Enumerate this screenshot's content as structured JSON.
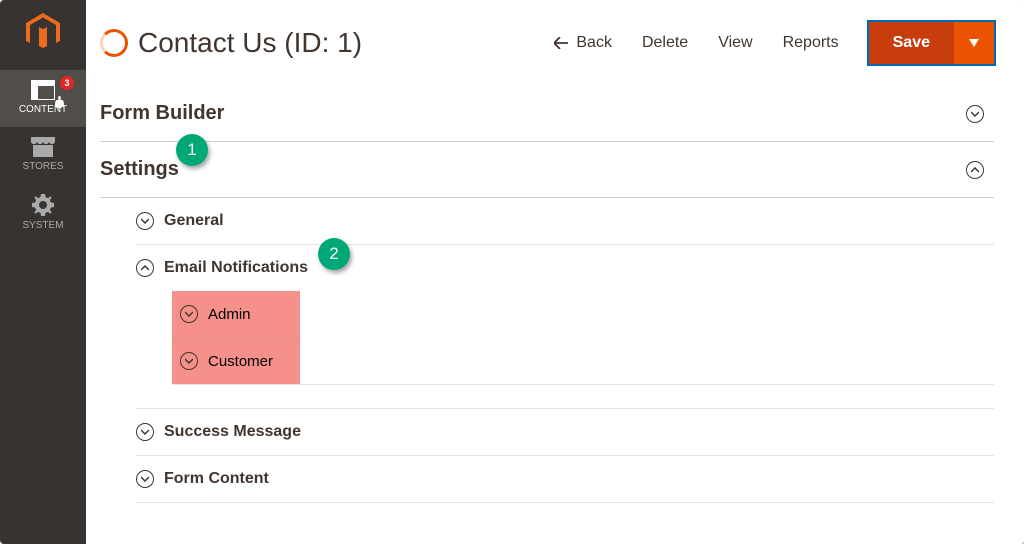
{
  "sidebar": {
    "items": [
      {
        "label": "CONTENT",
        "badge": "3"
      },
      {
        "label": "STORES"
      },
      {
        "label": "SYSTEM"
      }
    ]
  },
  "header": {
    "title": "Contact Us (ID: 1)",
    "actions": {
      "back": "Back",
      "delete": "Delete",
      "view": "View",
      "reports": "Reports",
      "save": "Save"
    }
  },
  "sections": {
    "form_builder": "Form Builder",
    "settings": "Settings",
    "general": "General",
    "email_notifications": "Email Notifications",
    "admin": "Admin",
    "customer": "Customer",
    "success_message": "Success Message",
    "form_content": "Form Content"
  },
  "annotations": {
    "b1": "1",
    "b2": "2"
  }
}
